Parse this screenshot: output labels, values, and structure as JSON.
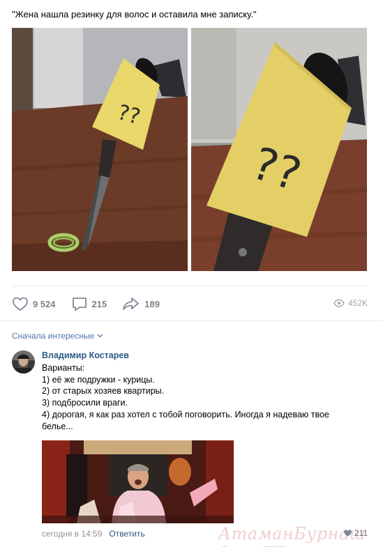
{
  "post": {
    "text": "\"Жена нашла резинку для волос и оставила мне записку.\"",
    "note_text": "??"
  },
  "actions": {
    "likes": "9 524",
    "comments": "215",
    "shares": "189",
    "views": "452K"
  },
  "comments_section": {
    "sort_label": "Сначала интересные"
  },
  "comment": {
    "author": "Владимир Костарев",
    "lines": [
      "Варианты:",
      "1) её же подружки - курицы.",
      "2) от старых хозяев квартиры.",
      "3) подбросили враги.",
      "4) дорогая, я как раз хотел с тобой поговорить. Иногда я надеваю твое",
      "белье..."
    ],
    "time": "сегодня в 14:59",
    "reply_label": "Ответить",
    "likes": "211"
  },
  "watermark": "АтаманБурнаш для ЯП",
  "colors": {
    "link": "#2a5885",
    "accent": "#4a76a8",
    "muted": "#828282",
    "divider": "#e7e8ec",
    "watermark": "#d66c6c"
  },
  "icons": {
    "like": "heart-icon",
    "comment": "comment-bubble-icon",
    "share": "share-arrow-icon",
    "views": "eye-icon",
    "sort": "chevron-down-icon"
  }
}
